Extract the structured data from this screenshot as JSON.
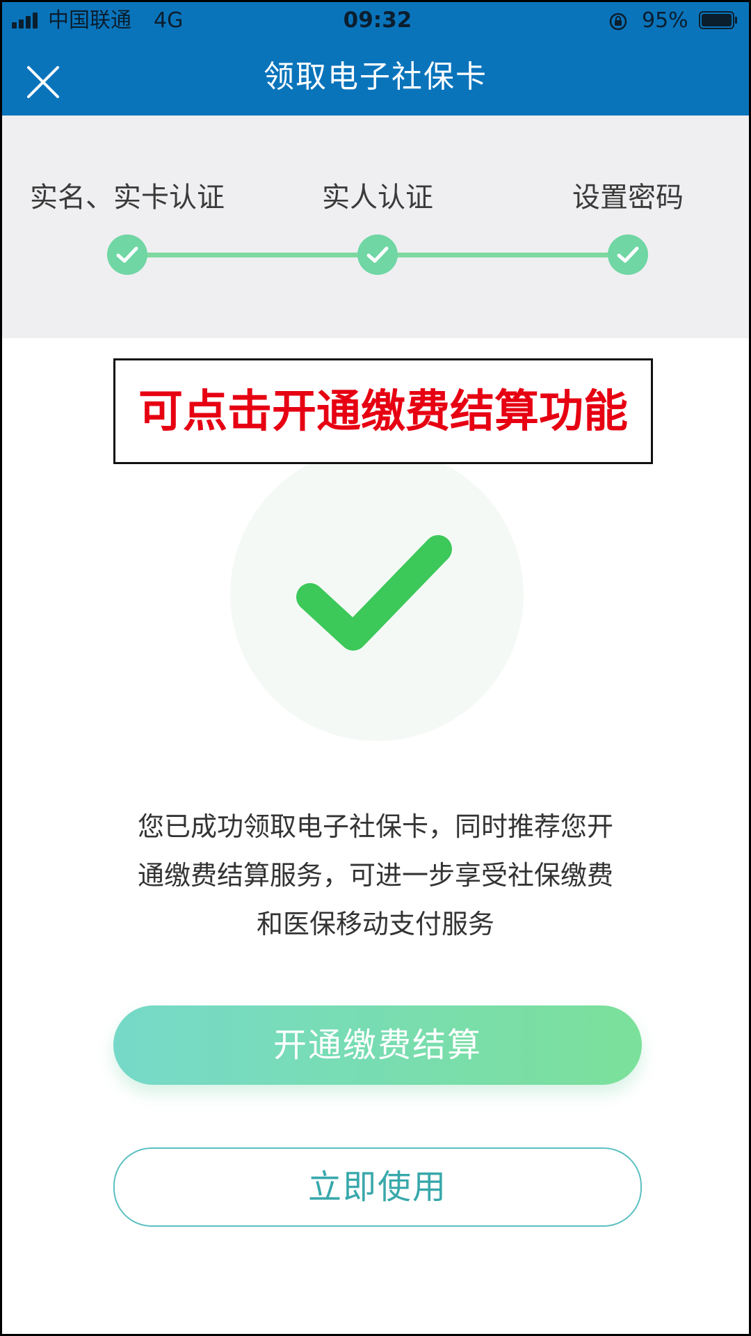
{
  "status_bar": {
    "carrier": "中国联通",
    "network": "4G",
    "time": "09:32",
    "battery": "95%"
  },
  "header": {
    "title": "领取电子社保卡",
    "close_icon": "close-icon"
  },
  "stepper": {
    "steps": [
      {
        "label": "实名、实卡认证",
        "done": true
      },
      {
        "label": "实人认证",
        "done": true
      },
      {
        "label": "设置密码",
        "done": true
      }
    ],
    "color": "#6fd6a4"
  },
  "annotation": {
    "text": "可点击开通缴费结算功能",
    "color": "#e60012"
  },
  "success": {
    "icon": "checkmark-icon",
    "color": "#3dc85a"
  },
  "message": {
    "lines": [
      "您已成功领取电子社保卡，同时推荐您开",
      "通缴费结算服务，可进一步享受社保缴费",
      "和医保移动支付服务"
    ]
  },
  "buttons": {
    "primary": "开通缴费结算",
    "secondary": "立即使用"
  },
  "colors": {
    "header_bg": "#0a74bb",
    "accent": "#76d9c9"
  }
}
